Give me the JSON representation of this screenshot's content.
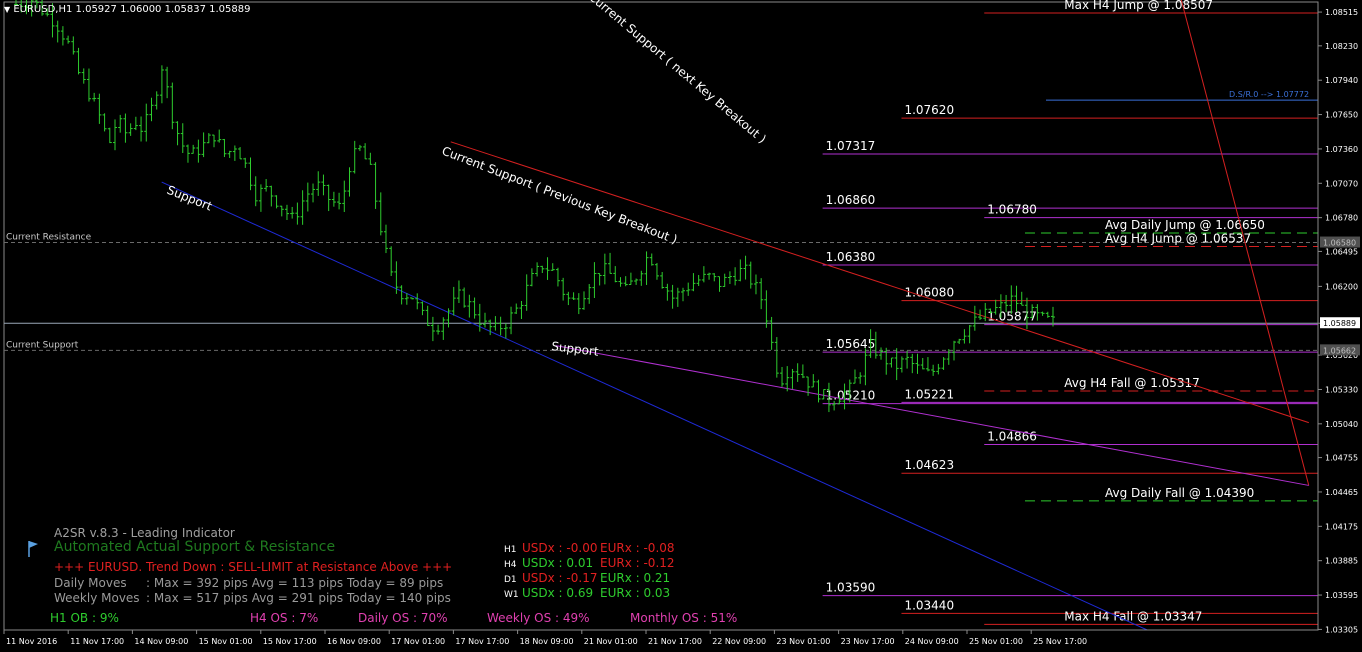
{
  "colors": {
    "background": "#000000",
    "candle": "#2ecc2e",
    "axis_text": "#ffffff",
    "red_line": "#d42020",
    "blue_line": "#1e2ad6",
    "purple_line": "#b030d0",
    "price_box": "#c0c0c0"
  },
  "header": {
    "symbol_line": "EURUSD,H1  1.05927 1.06000 1.05837 1.05889"
  },
  "chart_data": {
    "type": "candlestick",
    "symbol": "EURUSD",
    "timeframe": "H1",
    "ohlc": {
      "open": 1.05927,
      "high": 1.06,
      "low": 1.05837,
      "close": 1.05889
    },
    "ylim": [
      1.033,
      1.086
    ],
    "y_ticks": [
      "1.08515",
      "1.08230",
      "1.07940",
      "1.07650",
      "1.07360",
      "1.07070",
      "1.06780",
      "1.06495",
      "1.06200",
      "1.05889",
      "1.05620",
      "1.05330",
      "1.05040",
      "1.04755",
      "1.04465",
      "1.04175",
      "1.03885",
      "1.03595",
      "1.03305"
    ],
    "x_ticks": [
      "11 Nov 2016",
      "11 Nov 17:00",
      "14 Nov 09:00",
      "15 Nov 01:00",
      "15 Nov 17:00",
      "16 Nov 09:00",
      "17 Nov 01:00",
      "17 Nov 17:00",
      "18 Nov 09:00",
      "21 Nov 01:00",
      "21 Nov 17:00",
      "22 Nov 09:00",
      "23 Nov 01:00",
      "23 Nov 17:00",
      "24 Nov 09:00",
      "25 Nov 01:00",
      "25 Nov 17:00"
    ],
    "price_path": [
      [
        0,
        1.0858
      ],
      [
        0.8,
        1.0862
      ],
      [
        1.5,
        1.085
      ],
      [
        2,
        1.0843
      ],
      [
        2.6,
        1.0826
      ],
      [
        3.2,
        1.0798
      ],
      [
        3.8,
        1.078
      ],
      [
        4.3,
        1.076
      ],
      [
        4.7,
        1.074
      ],
      [
        5.1,
        1.076
      ],
      [
        5.6,
        1.0748
      ],
      [
        6,
        1.076
      ],
      [
        6.4,
        1.0752
      ],
      [
        6.9,
        1.0772
      ],
      [
        7.4,
        1.0808
      ],
      [
        7.8,
        1.077
      ],
      [
        8.3,
        1.0742
      ],
      [
        8.8,
        1.073
      ],
      [
        9.4,
        1.0738
      ],
      [
        10,
        1.0748
      ],
      [
        10.6,
        1.073
      ],
      [
        11.1,
        1.074
      ],
      [
        11.6,
        1.0722
      ],
      [
        12.1,
        1.0698
      ],
      [
        12.7,
        1.0702
      ],
      [
        13.4,
        1.0688
      ],
      [
        14,
        1.0676
      ],
      [
        14.6,
        1.0696
      ],
      [
        15.2,
        1.0706
      ],
      [
        15.8,
        1.0694
      ],
      [
        16.4,
        1.0686
      ],
      [
        16.9,
        1.0726
      ],
      [
        17.4,
        1.0736
      ],
      [
        17.9,
        1.0718
      ],
      [
        18.4,
        1.0672
      ],
      [
        18.9,
        1.063
      ],
      [
        19.4,
        1.0615
      ],
      [
        20,
        1.0612
      ],
      [
        20.6,
        1.0593
      ],
      [
        21.2,
        1.0585
      ],
      [
        21.8,
        1.0598
      ],
      [
        22.4,
        1.0612
      ],
      [
        23,
        1.0603
      ],
      [
        23.6,
        1.0588
      ],
      [
        24.2,
        1.0583
      ],
      [
        24.8,
        1.059
      ],
      [
        25.4,
        1.0603
      ],
      [
        26,
        1.0625
      ],
      [
        26.6,
        1.0638
      ],
      [
        27.2,
        1.0632
      ],
      [
        27.8,
        1.061
      ],
      [
        28.4,
        1.0606
      ],
      [
        29,
        1.0625
      ],
      [
        29.6,
        1.0635
      ],
      [
        30.2,
        1.0628
      ],
      [
        30.8,
        1.0616
      ],
      [
        31.4,
        1.063
      ],
      [
        32,
        1.0648
      ],
      [
        32.6,
        1.0625
      ],
      [
        33.2,
        1.061
      ],
      [
        33.8,
        1.0618
      ],
      [
        34.4,
        1.0625
      ],
      [
        35,
        1.0628
      ],
      [
        35.6,
        1.0622
      ],
      [
        36.2,
        1.063
      ],
      [
        36.8,
        1.0634
      ],
      [
        37.4,
        1.0618
      ],
      [
        37.8,
        1.0605
      ],
      [
        38.2,
        1.057
      ],
      [
        38.6,
        1.054
      ],
      [
        39.1,
        1.0552
      ],
      [
        39.6,
        1.0548
      ],
      [
        40.1,
        1.0538
      ],
      [
        40.6,
        1.053
      ],
      [
        41.1,
        1.0523
      ],
      [
        41.6,
        1.0528
      ],
      [
        42.1,
        1.0532
      ],
      [
        42.7,
        1.055
      ],
      [
        43.2,
        1.057
      ],
      [
        43.8,
        1.056
      ],
      [
        44.4,
        1.0552
      ],
      [
        45,
        1.0558
      ],
      [
        45.6,
        1.055
      ],
      [
        46.2,
        1.0545
      ],
      [
        46.8,
        1.056
      ],
      [
        47.4,
        1.0575
      ],
      [
        48,
        1.0584
      ],
      [
        48.6,
        1.0592
      ],
      [
        49.2,
        1.0598
      ],
      [
        49.8,
        1.0603
      ],
      [
        50.4,
        1.061
      ],
      [
        50.9,
        1.06
      ],
      [
        51.4,
        1.0596
      ],
      [
        51.9,
        1.0592
      ],
      [
        52.4,
        1.059
      ]
    ],
    "lines": [
      {
        "kind": "trend",
        "color": "red",
        "label": "Current Support ( next Key Breakout )",
        "from": [
          0.894,
          1.087
        ],
        "to": [
          0.993,
          1.0452
        ]
      },
      {
        "kind": "trend",
        "color": "red",
        "label": "Current Support ( Previous Key Breakout )",
        "from": [
          0.34,
          1.0742
        ],
        "to": [
          0.993,
          1.0505
        ]
      },
      {
        "kind": "trend",
        "color": "blue",
        "label": "Support",
        "from": [
          0.12,
          1.0708
        ],
        "to": [
          0.87,
          1.033
        ]
      },
      {
        "kind": "trend",
        "color": "purple",
        "label": "Support",
        "from": [
          0.42,
          1.057
        ],
        "to": [
          0.993,
          1.0452
        ]
      }
    ],
    "levels": [
      {
        "value": 1.08507,
        "label": "Max H4 Jump @ 1.08507",
        "color": "red",
        "style": "solid",
        "start": 0.746
      },
      {
        "value": 1.0762,
        "label": "1.07620",
        "color": "red",
        "style": "solid",
        "start": 0.683
      },
      {
        "value": 1.07317,
        "label": "1.07317",
        "color": "purple",
        "style": "solid",
        "start": 0.623
      },
      {
        "value": 1.0686,
        "label": "1.06860",
        "color": "purple",
        "style": "solid",
        "start": 0.623
      },
      {
        "value": 1.0678,
        "label": "1.06780",
        "color": "purple",
        "style": "solid",
        "start": 0.746
      },
      {
        "value": 1.0665,
        "label": "Avg Daily Jump @ 1.06650",
        "color": "green",
        "style": "dash",
        "start": 0.777
      },
      {
        "value": 1.06537,
        "label": "Avg H4 Jump @ 1.06537",
        "color": "red",
        "style": "dash",
        "start": 0.777
      },
      {
        "value": 1.0638,
        "label": "1.06380",
        "color": "purple",
        "style": "solid",
        "start": 0.623
      },
      {
        "value": 1.0608,
        "label": "1.06080",
        "color": "red",
        "style": "solid",
        "start": 0.683
      },
      {
        "value": 1.05877,
        "label": "1.05877",
        "color": "purple",
        "style": "solid",
        "start": 0.746
      },
      {
        "value": 1.05645,
        "label": "1.05645",
        "color": "purple",
        "style": "solid",
        "start": 0.623
      },
      {
        "value": 1.05317,
        "label": "Avg H4 Fall @ 1.05317",
        "color": "red",
        "style": "dash",
        "start": 0.746
      },
      {
        "value": 1.05221,
        "label": "1.05221",
        "color": "purple",
        "style": "solid",
        "start": 0.683
      },
      {
        "value": 1.0521,
        "label": "1.05210",
        "color": "purple",
        "style": "solid",
        "start": 0.623
      },
      {
        "value": 1.04866,
        "label": "1.04866",
        "color": "purple",
        "style": "solid",
        "start": 0.746
      },
      {
        "value": 1.04623,
        "label": "1.04623",
        "color": "red",
        "style": "solid",
        "start": 0.683
      },
      {
        "value": 1.0439,
        "label": "Avg Daily Fall @ 1.04390",
        "color": "green",
        "style": "dash",
        "start": 0.777
      },
      {
        "value": 1.0359,
        "label": "1.03590",
        "color": "purple",
        "style": "solid",
        "start": 0.623
      },
      {
        "value": 1.0344,
        "label": "1.03440",
        "color": "red",
        "style": "solid",
        "start": 0.683
      },
      {
        "value": 1.03347,
        "label": "Max H4 Fall @ 1.03347",
        "color": "red",
        "style": "solid",
        "start": 0.746
      }
    ],
    "horizontal_markers": [
      {
        "value": 1.0657,
        "label": "Current Resistance",
        "box": "1.06580"
      },
      {
        "value": 1.05889,
        "label": "",
        "box": "1.05889"
      },
      {
        "value": 1.0566,
        "label": "Current Support",
        "box": "1.05662"
      }
    ],
    "ds_line": {
      "value": 1.07772,
      "label": "D.S/R.0 --> 1.07772"
    }
  },
  "indicator": {
    "title": "A2SR v.8.3 - Leading Indicator",
    "subtitle": "Automated Actual Support & Resistance",
    "signal": "+++ EURUSD. Trend Down : SELL-LIMIT at Resistance Above +++",
    "daily_label": "Daily Moves",
    "daily_value": ": Max = 392 pips Avg = 113 pips Today = 89 pips",
    "weekly_label": "Weekly Moves",
    "weekly_value": ": Max = 517 pips Avg = 291 pips Today = 140 pips",
    "os_items": [
      {
        "text": "H1 OB : 9%",
        "color": "#2ecc2e"
      },
      {
        "text": "H4 OS : 7%",
        "color": "#e040b0"
      },
      {
        "text": "Daily OS : 70%",
        "color": "#e040b0"
      },
      {
        "text": "Weekly OS : 49%",
        "color": "#e040b0"
      },
      {
        "text": "Monthly OS : 51%",
        "color": "#e040b0"
      }
    ],
    "strength": [
      {
        "tf": "H1",
        "usd": "USDx : -0.00",
        "eur": "EURx : -0.08",
        "usd_color": "#e02020",
        "eur_color": "#e02020"
      },
      {
        "tf": "H4",
        "usd": "USDx : 0.01",
        "eur": "EURx : -0.12",
        "usd_color": "#2ecc2e",
        "eur_color": "#e02020"
      },
      {
        "tf": "D1",
        "usd": "USDx : -0.17",
        "eur": "EURx : 0.21",
        "usd_color": "#e02020",
        "eur_color": "#2ecc2e"
      },
      {
        "tf": "W1",
        "usd": "USDx : 0.69",
        "eur": "EURx : 0.03",
        "usd_color": "#2ecc2e",
        "eur_color": "#2ecc2e"
      }
    ]
  }
}
